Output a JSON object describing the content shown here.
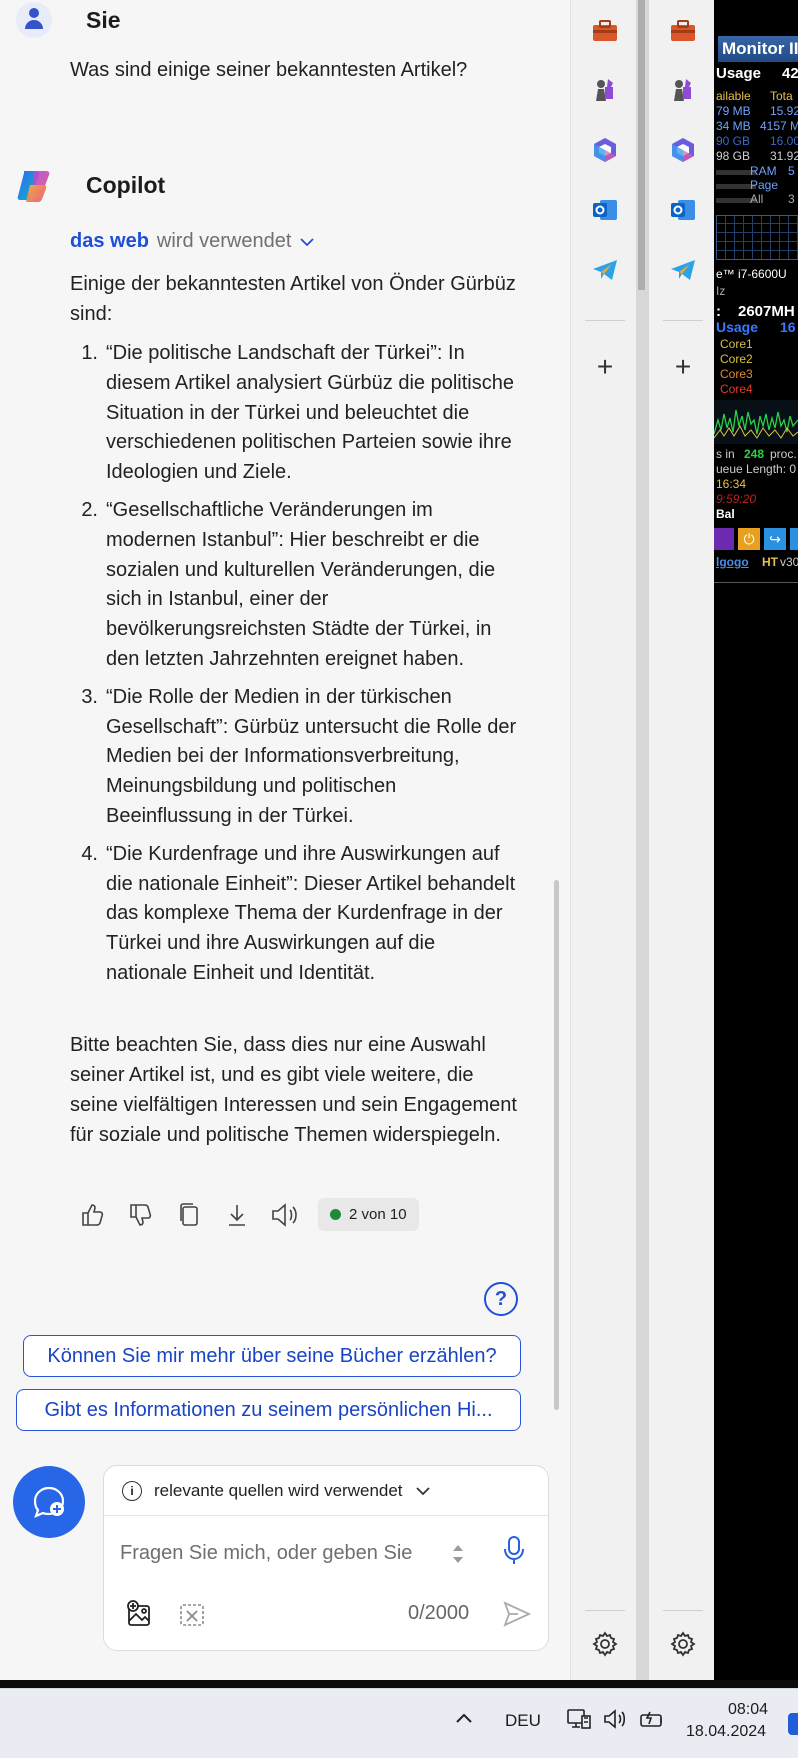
{
  "chat": {
    "user_name": "Sie",
    "user_question": "Was sind einige seiner bekanntesten Artikel?",
    "assistant_name": "Copilot",
    "web_search": {
      "highlight": "das web",
      "rest": "wird verwendet"
    },
    "intro": "Einige der bekanntesten Artikel von Önder Gürbüz sind:",
    "articles": [
      {
        "num": "1.",
        "text": "“Die politische Landschaft der Türkei”: In diesem Artikel analysiert Gürbüz die politische Situation in der Türkei und beleuchtet die verschiedenen politischen Parteien sowie ihre Ideologien und Ziele."
      },
      {
        "num": "2.",
        "text": "“Gesellschaftliche Veränderungen im modernen Istanbul”: Hier beschreibt er die sozialen und kulturellen Veränderungen, die sich in Istanbul, einer der bevölkerungsreichsten Städte der Türkei, in den letzten Jahrzehnten ereignet haben."
      },
      {
        "num": "3.",
        "text": "“Die Rolle der Medien in der türkischen Gesellschaft”: Gürbüz untersucht die Rolle der Medien bei der Informationsverbreitung, Meinungsbildung und politischen Beeinflussung in der Türkei."
      },
      {
        "num": "4.",
        "text": "“Die Kurdenfrage und ihre Auswirkungen auf die nationale Einheit”: Dieser Artikel behandelt das komplexe Thema der Kurdenfrage in der Türkei und ihre Auswirkungen auf die nationale Einheit und Identität."
      }
    ],
    "outro": "Bitte beachten Sie, dass dies nur eine Auswahl seiner Artikel ist, und es gibt viele weitere, die seine vielfältigen Interessen und sein Engagement für soziale und politische Themen widerspiegeln.",
    "response_counter": "2 von 10",
    "help_glyph": "?",
    "suggestions": [
      "Können Sie mir mehr über seine Bücher erzählen?",
      "Gibt es Informationen zu seinem persönlichen Hi..."
    ]
  },
  "composer": {
    "source_label": "relevante quellen wird verwendet",
    "info_glyph": "i",
    "placeholder": "Fragen Sie mich, oder geben Sie",
    "char_count": "0/2000"
  },
  "sidebar": {
    "icons": [
      "toolbox-icon",
      "chess-icon",
      "m365-icon",
      "outlook-icon",
      "telegram-icon"
    ],
    "add_glyph": "+",
    "settings_icon": "gear-icon"
  },
  "monitor": {
    "title": "Monitor II",
    "usage_label": "Usage",
    "usage_value": "42",
    "rows": [
      {
        "a": "ailable",
        "b": "Tota",
        "color": "#e5c04a"
      },
      {
        "a": "79 MB",
        "b": "15.92",
        "color": "#6ea0ff"
      },
      {
        "a": "34 MB",
        "b": "4157 M",
        "color": "#6ea0ff"
      },
      {
        "a": "90 GB",
        "b": "16.00",
        "color": "#3966c8"
      },
      {
        "a": "98 GB",
        "b": "31.92",
        "color": "#cfcfcf"
      }
    ],
    "mem_labels": [
      "RAM",
      "Page",
      "All"
    ],
    "mem_values": [
      "5",
      "",
      "3"
    ],
    "cpu_name": "e™ i7-6600U",
    "hz_label": "Iz",
    "freq": "2607MH",
    "usage2_label": "Usage",
    "usage2_value": "16",
    "cores": [
      {
        "label": "Core1",
        "color": "#d4c13e"
      },
      {
        "label": "Core2",
        "color": "#d4c13e"
      },
      {
        "label": "Core3",
        "color": "#e08a2c"
      },
      {
        "label": "Core4",
        "color": "#e03a2c"
      }
    ],
    "proc_prefix": "s in",
    "proc_count": "248",
    "proc_suffix": "proc.",
    "queue": "ueue Length: 0",
    "time1": "16:34",
    "time2": "9:59:20",
    "bal": "Bal",
    "link": "lgogo",
    "ht": "HT",
    "ver": "v30"
  },
  "taskbar": {
    "language": "DEU",
    "time": "08:04",
    "date": "18.04.2024"
  }
}
